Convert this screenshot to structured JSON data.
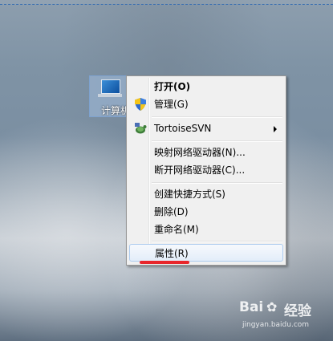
{
  "desktop": {
    "icon_label": "计算机"
  },
  "context_menu": {
    "items": [
      {
        "label": "打开(O)",
        "bold": true
      },
      {
        "label": "管理(G)",
        "icon": "uac-shield-icon"
      },
      {
        "label": "TortoiseSVN",
        "icon": "tortoisesvn-icon",
        "submenu": true
      },
      {
        "label": "映射网络驱动器(N)..."
      },
      {
        "label": "断开网络驱动器(C)..."
      },
      {
        "label": "创建快捷方式(S)"
      },
      {
        "label": "删除(D)"
      },
      {
        "label": "重命名(M)"
      },
      {
        "label": "属性(R)",
        "highlighted": true
      }
    ]
  },
  "watermark": {
    "brand_left": "Bai",
    "brand_right": "经验",
    "site": "jingyan.baidu.com"
  },
  "colors": {
    "annotation_underline": "#e8262b",
    "highlight_border": "#aeccef"
  }
}
